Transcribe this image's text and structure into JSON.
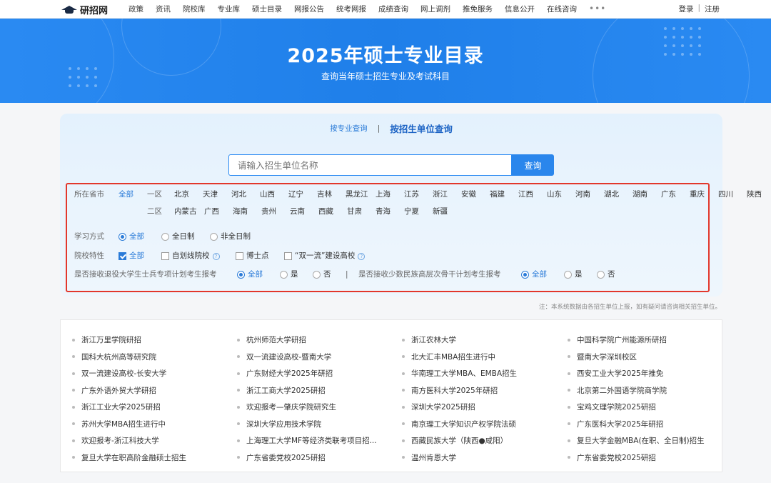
{
  "nav": {
    "logo": "研招网",
    "items": [
      "政策",
      "资讯",
      "院校库",
      "专业库",
      "硕士目录",
      "网报公告",
      "统考网报",
      "成绩查询",
      "网上调剂",
      "推免服务",
      "信息公开",
      "在线咨询"
    ],
    "more": "•••",
    "login": "登录",
    "divider": "|",
    "register": "注册"
  },
  "banner": {
    "title": "2025年硕士专业目录",
    "subtitle": "查询当年硕士招生专业及考试科目"
  },
  "tabs": {
    "by_major": "按专业查询",
    "sep": "|",
    "by_unit": "按招生单位查询"
  },
  "search": {
    "placeholder": "请输入招生单位名称",
    "button": "查询"
  },
  "filters": {
    "province_label": "所在省市",
    "all": "全部",
    "zone1": "一区",
    "zone1_provinces": [
      "北京",
      "天津",
      "河北",
      "山西",
      "辽宁",
      "吉林",
      "黑龙江",
      "上海",
      "江苏",
      "浙江",
      "安徽",
      "福建",
      "江西",
      "山东",
      "河南",
      "湖北",
      "湖南",
      "广东",
      "重庆",
      "四川",
      "陕西"
    ],
    "zone2": "二区",
    "zone2_provinces": [
      "内蒙古",
      "广西",
      "海南",
      "贵州",
      "云南",
      "西藏",
      "甘肃",
      "青海",
      "宁夏",
      "新疆"
    ],
    "study_label": "学习方式",
    "study_options": [
      "全部",
      "全日制",
      "非全日制"
    ],
    "school_label": "院校特性",
    "school_options": [
      "全部",
      "自划线院校",
      "博士点",
      "“双一流”建设高校"
    ],
    "veteran_label": "是否接收退役大学生士兵专项计划考生报考",
    "veteran_options": [
      "全部",
      "是",
      "否"
    ],
    "filter_sep": "|",
    "minority_label": "是否接收少数民族高层次骨干计划考生报考",
    "minority_options": [
      "全部",
      "是",
      "否"
    ]
  },
  "note": "注：本系统数据由各招生单位上报，如有疑问请咨询相关招生单位。",
  "list": {
    "col1": [
      "浙江万里学院研招",
      "国科大杭州高等研究院",
      "双一流建设高校-长安大学",
      "广东外语外贸大学研招",
      "浙江工业大学2025研招",
      "苏州大学MBA招生进行中",
      "欢迎报考-浙江科技大学",
      "复旦大学在职高阶金融硕士招生"
    ],
    "col2": [
      "杭州师范大学研招",
      "双一流建设高校-暨南大学",
      "广东财经大学2025年研招",
      "浙江工商大学2025研招",
      "欢迎报考—肇庆学院研究生",
      "深圳大学应用技术学院",
      "上海理工大学MF等经济类联考项目招...",
      "广东省委党校2025研招"
    ],
    "col3": [
      "浙江农林大学",
      "北大汇丰MBA招生进行中",
      "华南理工大学MBA、EMBA招生",
      "南方医科大学2025年研招",
      "深圳大学2025研招",
      "南京理工大学知识产权学院法硕",
      "西藏民族大学（陕西●咸阳）",
      "温州肯恩大学"
    ],
    "col4": [
      "中国科学院广州能源所研招",
      "暨南大学深圳校区",
      "西安工业大学2025年推免",
      "北京第二外国语学院商学院",
      "宝鸡文理学院2025研招",
      "广东医科大学2025年研招",
      "复旦大学金融MBA(在职、全日制)招生",
      "广东省委党校2025研招"
    ]
  }
}
